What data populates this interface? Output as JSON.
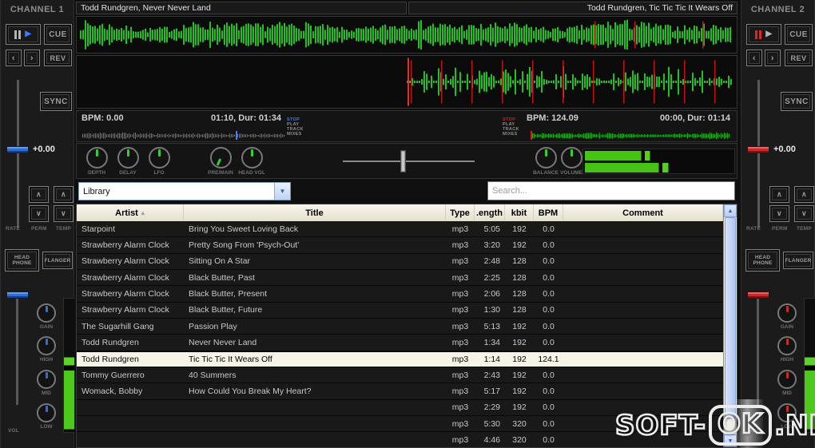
{
  "channel1": {
    "title": "CHANNEL 1",
    "play_icon": "▶",
    "cue": "CUE",
    "step_back": "‹",
    "step_fwd": "›",
    "rev": "REV",
    "sync": "SYNC",
    "pitch_value": "+0.00",
    "up_icon": "∧",
    "down_icon": "∨",
    "rate": "RATE",
    "perm": "PERM",
    "temp": "TEMP",
    "headphone": "HEAD PHONE",
    "flanger": "FLANGER",
    "vol": "VOL",
    "knobs": [
      "GAIN",
      "HIGH",
      "MID",
      "LOW"
    ],
    "accent": "#2f6fd4",
    "pause_color": "#b4b4b4",
    "play_color": "#3d7bff"
  },
  "channel2": {
    "title": "CHANNEL 2",
    "play_icon": "▶",
    "cue": "CUE",
    "step_back": "‹",
    "step_fwd": "›",
    "rev": "REV",
    "sync": "SYNC",
    "pitch_value": "+0.00",
    "up_icon": "∧",
    "down_icon": "∨",
    "rate": "RATE",
    "perm": "PERM",
    "temp": "TEMP",
    "headphone": "HEAD PHONE",
    "flanger": "FLANGER",
    "vol": "VOL",
    "knobs": [
      "GAIN",
      "HIGH",
      "MID",
      "LOW"
    ],
    "accent": "#c82a2a",
    "pause_color": "#d22a2a",
    "play_color": "#b4b4b4"
  },
  "deck_left": {
    "track_title": "Todd Rundgren, Never Never Land",
    "bpm": "BPM:  0.00",
    "time": "01:10, Dur: 01:34",
    "tags": [
      "STOP",
      "PLAY",
      "TRACK",
      "MIXES"
    ]
  },
  "deck_right": {
    "track_title": "Todd Rundgren, Tic Tic Tic It Wears Off",
    "bpm": "BPM: 124.09",
    "time": "00:00, Dur: 01:14",
    "tags": [
      "STOP",
      "PLAY",
      "TRACK",
      "MIXES"
    ]
  },
  "mixer": {
    "fx_knobs": [
      "DEPTH",
      "DELAY",
      "LFO"
    ],
    "head_knobs": [
      "PRE/MAIN",
      "HEAD VOL"
    ],
    "master_knobs": [
      "BALANCE",
      "VOLUME"
    ]
  },
  "browser": {
    "source": "Library",
    "dropdown_icon": "▼",
    "search_placeholder": "Search..."
  },
  "library": {
    "columns": [
      "Artist",
      "Title",
      "Type",
      ".ength",
      "kbit",
      "BPM",
      "Comment"
    ],
    "sort_column": "Artist",
    "sort_icon": "▴",
    "scroll_up_icon": "▲",
    "scroll_down_icon": "▼",
    "rows": [
      {
        "artist": "Starpoint",
        "title": "Bring You Sweet Loving Back",
        "type": "mp3",
        "length": "5:05",
        "kbit": "192",
        "bpm": "0.0",
        "comment": "",
        "selected": false
      },
      {
        "artist": "Strawberry Alarm Clock",
        "title": "Pretty Song From 'Psych-Out'",
        "type": "mp3",
        "length": "3:20",
        "kbit": "192",
        "bpm": "0.0",
        "comment": "",
        "selected": false
      },
      {
        "artist": "Strawberry Alarm Clock",
        "title": "Sitting On A Star",
        "type": "mp3",
        "length": "2:48",
        "kbit": "128",
        "bpm": "0.0",
        "comment": "",
        "selected": false
      },
      {
        "artist": "Strawberry Alarm Clock",
        "title": "Black Butter, Past",
        "type": "mp3",
        "length": "2:25",
        "kbit": "128",
        "bpm": "0.0",
        "comment": "",
        "selected": false
      },
      {
        "artist": "Strawberry Alarm Clock",
        "title": "Black Butter, Present",
        "type": "mp3",
        "length": "2:06",
        "kbit": "128",
        "bpm": "0.0",
        "comment": "",
        "selected": false
      },
      {
        "artist": "Strawberry Alarm Clock",
        "title": "Black Butter, Future",
        "type": "mp3",
        "length": "1:30",
        "kbit": "128",
        "bpm": "0.0",
        "comment": "",
        "selected": false
      },
      {
        "artist": "The Sugarhill Gang",
        "title": "Passion Play",
        "type": "mp3",
        "length": "5:13",
        "kbit": "192",
        "bpm": "0.0",
        "comment": "",
        "selected": false
      },
      {
        "artist": "Todd Rundgren",
        "title": "Never Never Land",
        "type": "mp3",
        "length": "1:34",
        "kbit": "192",
        "bpm": "0.0",
        "comment": "",
        "selected": false
      },
      {
        "artist": "Todd Rundgren",
        "title": "Tic Tic Tic It Wears Off",
        "type": "mp3",
        "length": "1:14",
        "kbit": "192",
        "bpm": "124.1",
        "comment": "",
        "selected": true
      },
      {
        "artist": "Tommy Guerrero",
        "title": "40 Summers",
        "type": "mp3",
        "length": "2:43",
        "kbit": "192",
        "bpm": "0.0",
        "comment": "",
        "selected": false
      },
      {
        "artist": "Womack, Bobby",
        "title": "How Could You Break My Heart?",
        "type": "mp3",
        "length": "5:17",
        "kbit": "192",
        "bpm": "0.0",
        "comment": "",
        "selected": false
      },
      {
        "artist": "",
        "title": "",
        "type": "mp3",
        "length": "2:29",
        "kbit": "192",
        "bpm": "0.0",
        "comment": "",
        "selected": false
      },
      {
        "artist": "",
        "title": "",
        "type": "mp3",
        "length": "5:30",
        "kbit": "320",
        "bpm": "0.0",
        "comment": "",
        "selected": false
      },
      {
        "artist": "",
        "title": "",
        "type": "mp3",
        "length": "4:46",
        "kbit": "320",
        "bpm": "0.0",
        "comment": "",
        "selected": false
      }
    ]
  },
  "watermark": {
    "p1": "SOFT-",
    "p2": "OK",
    "p3": ".NET"
  },
  "colors": {
    "wave_green": "#1ec41e",
    "vu_green": "#4ec81c",
    "cue_red": "#c21515",
    "accent_blue": "#2f6fd4",
    "accent_red": "#c82a2a",
    "header_bg": "#ece9d8",
    "selected_row": "#f6f3e7"
  }
}
